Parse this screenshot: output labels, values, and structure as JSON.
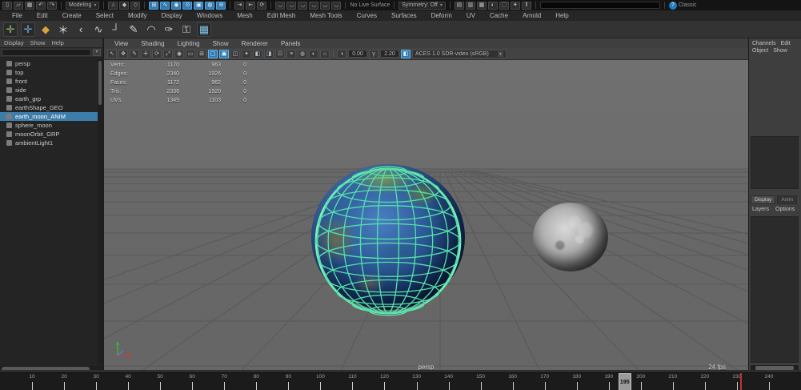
{
  "status_bar": {
    "file_icons": [
      {
        "name": "new-scene-icon",
        "glyph": "▯"
      },
      {
        "name": "open-scene-icon",
        "glyph": "▱"
      },
      {
        "name": "save-scene-icon",
        "glyph": "▦"
      },
      {
        "name": "undo-icon",
        "glyph": "↶"
      },
      {
        "name": "redo-icon",
        "glyph": "↷"
      }
    ],
    "menuset_value": "Modeling",
    "selection_icons": [
      {
        "name": "select-hierarchy-icon",
        "glyph": "⌂"
      },
      {
        "name": "select-object-icon",
        "glyph": "◆"
      },
      {
        "name": "select-component-icon",
        "glyph": "◇"
      }
    ],
    "snap_icons": [
      {
        "name": "snap-grid-icon",
        "glyph": "⊞",
        "active": true
      },
      {
        "name": "snap-curve-icon",
        "glyph": "∿",
        "active": true
      },
      {
        "name": "snap-point-icon",
        "glyph": "◉",
        "active": true
      },
      {
        "name": "snap-projected-center-icon",
        "glyph": "⊙",
        "active": true
      },
      {
        "name": "snap-view-plane-icon",
        "glyph": "▣",
        "active": true
      },
      {
        "name": "make-live-icon",
        "glyph": "◍",
        "active": true
      },
      {
        "name": "snap-together-icon",
        "glyph": "⊚",
        "active": true
      }
    ],
    "history_icons": [
      {
        "name": "input-connections-icon",
        "glyph": "⇥"
      },
      {
        "name": "output-connections-icon",
        "glyph": "⇤"
      },
      {
        "name": "construction-history-icon",
        "glyph": "⟳"
      }
    ],
    "magnet_icons": [
      {
        "name": "magnet-grid-icon",
        "glyph": "◡"
      },
      {
        "name": "magnet-curve-icon",
        "glyph": "◡"
      },
      {
        "name": "magnet-point-icon",
        "glyph": "◡"
      },
      {
        "name": "magnet-plane-icon",
        "glyph": "◡"
      },
      {
        "name": "magnet-view-icon",
        "glyph": "◡"
      },
      {
        "name": "magnet-center-icon",
        "glyph": "◡"
      }
    ],
    "live_surface_label": "No Live Surface",
    "symmetry_value": "Symmetry: Off",
    "render_icons": [
      {
        "name": "render-frame-icon",
        "glyph": "▤"
      },
      {
        "name": "ipr-render-icon",
        "glyph": "▥"
      },
      {
        "name": "render-sequence-icon",
        "glyph": "▦"
      },
      {
        "name": "hypershade-icon",
        "glyph": "◐"
      },
      {
        "name": "render-settings-icon",
        "glyph": "⬚"
      },
      {
        "name": "light-editor-icon",
        "glyph": "✦"
      },
      {
        "name": "pause-icon",
        "glyph": "‖"
      }
    ],
    "command_field_value": "",
    "workspace_label": "Classic"
  },
  "menu_bar": {
    "items": [
      "File",
      "Edit",
      "Create",
      "Select",
      "Modify",
      "Display",
      "Windows",
      "Mesh",
      "Edit Mesh",
      "Mesh Tools",
      "Curves",
      "Surfaces",
      "Deform",
      "UV",
      "Cache",
      "Arnold",
      "Help"
    ]
  },
  "shelf": {
    "icons": [
      {
        "name": "xyz-manipulator-icon",
        "glyph": "✛",
        "color": "#8fbf6f",
        "boxed": true
      },
      {
        "name": "xyz-snap-manipulator-icon",
        "glyph": "✛",
        "color": "#6fa7d9",
        "boxed": true
      },
      {
        "name": "locator-icon",
        "glyph": "◆",
        "color": "#d9a23c",
        "boxed": false
      },
      {
        "name": "ep-curve-tool-icon",
        "glyph": "＊",
        "color": "#e8e8e8",
        "boxed": false
      },
      {
        "name": "angle-curve-icon",
        "glyph": "‹",
        "color": "#dddddd",
        "boxed": false
      },
      {
        "name": "cv-curve-tool-icon",
        "glyph": "∿",
        "color": "#cfcfcf",
        "boxed": false
      },
      {
        "name": "bezier-curve-tool-icon",
        "glyph": "┘",
        "color": "#cfcfcf",
        "boxed": false
      },
      {
        "name": "pencil-curve-tool-icon",
        "glyph": "✎",
        "color": "#cfcfcf",
        "boxed": false
      },
      {
        "name": "arc-tool-icon",
        "glyph": "◠",
        "color": "#cfcfcf",
        "boxed": false
      },
      {
        "name": "curve-edit-icon",
        "glyph": "✑",
        "color": "#cfcfcf",
        "boxed": false
      },
      {
        "name": "knife-tool-icon",
        "glyph": "⚿",
        "color": "#cfcfcf",
        "boxed": false
      },
      {
        "name": "image-plane-icon",
        "glyph": "▦",
        "color": "#7fc4e8",
        "boxed": true
      }
    ]
  },
  "outliner": {
    "menus": [
      "Display",
      "Show",
      "Help"
    ],
    "search_placeholder": "",
    "items": [
      {
        "label": "persp",
        "selected": false
      },
      {
        "label": "top",
        "selected": false
      },
      {
        "label": "front",
        "selected": false
      },
      {
        "label": "side",
        "selected": false
      },
      {
        "label": "earth_grp",
        "selected": false
      },
      {
        "label": "earthShape_GEO",
        "selected": false
      },
      {
        "label": "earth_moon_ANIM",
        "selected": true
      },
      {
        "label": "sphere_moon",
        "selected": false
      },
      {
        "label": "moonOrbit_GRP",
        "selected": false
      },
      {
        "label": "ambientLight1",
        "selected": false
      }
    ]
  },
  "panel": {
    "menus": [
      "View",
      "Shading",
      "Lighting",
      "Show",
      "Renderer",
      "Panels"
    ],
    "toolbar_icons": [
      {
        "name": "select-tool-icon",
        "glyph": "↖",
        "active": false
      },
      {
        "name": "lasso-tool-icon",
        "glyph": "✥",
        "active": false
      },
      {
        "name": "paint-select-icon",
        "glyph": "✎",
        "active": false
      },
      {
        "name": "move-tool-icon",
        "glyph": "✛",
        "active": false
      },
      {
        "name": "rotate-tool-icon",
        "glyph": "⟳",
        "active": false
      },
      {
        "name": "scale-tool-icon",
        "glyph": "⤢",
        "active": false
      },
      {
        "name": "snap-icon",
        "glyph": "◉",
        "active": false
      },
      {
        "name": "camera-lock-icon",
        "glyph": "▭",
        "active": false
      },
      {
        "name": "grid-toggle-icon",
        "glyph": "⊞",
        "active": false
      },
      {
        "name": "wireframe-mode-icon",
        "glyph": "▢",
        "active": true
      },
      {
        "name": "shaded-mode-icon",
        "glyph": "▣",
        "active": true
      },
      {
        "name": "textured-mode-icon",
        "glyph": "◫",
        "active": false
      },
      {
        "name": "lighting-toggle-icon",
        "glyph": "✦",
        "active": false
      },
      {
        "name": "shadows-toggle-icon",
        "glyph": "◧",
        "active": false
      },
      {
        "name": "screen-space-ao-icon",
        "glyph": "◨",
        "active": false
      },
      {
        "name": "motion-blur-icon",
        "glyph": "⊡",
        "active": false
      },
      {
        "name": "multisampling-icon",
        "glyph": "≡",
        "active": false
      },
      {
        "name": "isolate-select-icon",
        "glyph": "◍",
        "active": false
      },
      {
        "name": "xray-icon",
        "glyph": "◐",
        "active": false
      },
      {
        "name": "camera-attributes-icon",
        "glyph": "⌂",
        "active": false
      }
    ],
    "exposure_value": "0.00",
    "gamma_value": "2.20",
    "view_transform_value": "ACES 1.0 SDR-video (sRGB)"
  },
  "viewport": {
    "hud_rows": [
      {
        "label": "Verts:",
        "total": "1170",
        "selected": "963",
        "component": "0"
      },
      {
        "label": "Edges:",
        "total": "2340",
        "selected": "1926",
        "component": "0"
      },
      {
        "label": "Faces:",
        "total": "1172",
        "selected": "962",
        "component": "0"
      },
      {
        "label": "Tris:",
        "total": "2336",
        "selected": "1920",
        "component": "0"
      },
      {
        "label": "UVs:",
        "total": "1349",
        "selected": "1103",
        "component": "0"
      }
    ],
    "camera_label": "persp",
    "fps_label": "24 fps"
  },
  "channel_box": {
    "menus": [
      "Channels",
      "Edit",
      "Object",
      "Show"
    ]
  },
  "layer_editor": {
    "tabs": [
      "Display",
      "Anim"
    ],
    "menus": [
      "Layers",
      "Options"
    ]
  },
  "timeline": {
    "start": 1,
    "end": 250,
    "label_step": 10,
    "label_max": 240,
    "current_frame": 195,
    "key_frame": 231
  },
  "colors": {
    "selection_blue": "#3d7dab",
    "wireframe_selected": "#54e0a8",
    "active_icon_blue": "#2e7bb5"
  }
}
